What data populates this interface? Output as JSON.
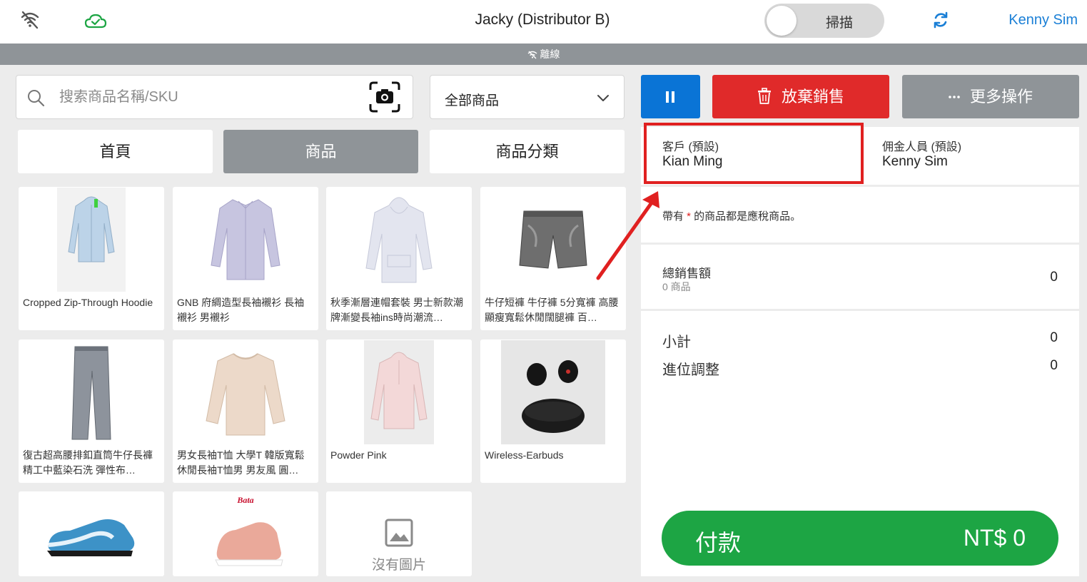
{
  "header": {
    "title": "Jacky (Distributor B)",
    "scan_label": "掃描",
    "user": "Kenny Sim"
  },
  "offline_label": "離線",
  "search": {
    "placeholder": "搜索商品名稱/SKU"
  },
  "category_filter": {
    "selected": "全部商品"
  },
  "tabs": [
    {
      "label": "首頁",
      "active": false
    },
    {
      "label": "商品",
      "active": true
    },
    {
      "label": "商品分類",
      "active": false
    }
  ],
  "products": [
    {
      "name": "Cropped Zip-Through Hoodie",
      "image": "light-blue-hoodie"
    },
    {
      "name": "GNB 府綢造型長袖襯衫 長袖襯衫 男襯衫",
      "image": "lavender-shirt"
    },
    {
      "name": "秋季漸層連帽套裝 男士新款潮牌漸變長袖ins時尚潮流…",
      "image": "grey-hoodie"
    },
    {
      "name": "牛仔短褲 牛仔褲 5分寬褲 高腰顯瘦寬鬆休閒闊腿褲 百…",
      "image": "denim-shorts"
    },
    {
      "name": "復古超高腰排釦直筒牛仔長褲 精工中藍染石洗 彈性布…",
      "image": "grey-jeans"
    },
    {
      "name": "男女長袖T恤 大學T 韓版寬鬆休閒長袖T恤男 男友風 圓…",
      "image": "beige-sweater"
    },
    {
      "name": "Powder Pink",
      "image": "pink-hoodie"
    },
    {
      "name": "Wireless-Earbuds",
      "image": "black-earbuds"
    },
    {
      "name": "",
      "image": "blue-sneaker"
    },
    {
      "name": "",
      "image": "pink-sneaker",
      "brand": "Bata"
    },
    {
      "name": "",
      "image": "no-image",
      "no_image_label": "沒有圖片"
    }
  ],
  "actions": {
    "discard_label": "放棄銷售",
    "more_label": "更多操作"
  },
  "customer": {
    "label": "客戶 (預設)",
    "value": "Kian Ming"
  },
  "commission": {
    "label": "佣金人員 (預設)",
    "value": "Kenny Sim"
  },
  "tax_note": {
    "star": "*",
    "text_before": "帶有 ",
    "text_after": " 的商品都是應稅商品。"
  },
  "summary": {
    "total_label": "總銷售額",
    "items_count": "0 商品",
    "total_value": "0",
    "subtotal_label": "小計",
    "subtotal_value": "0",
    "rounding_label": "進位調整",
    "rounding_value": "0"
  },
  "pay": {
    "label": "付款",
    "amount": "NT$ 0"
  },
  "colors": {
    "accent_blue": "#0a74d6",
    "discard_red": "#e02a2a",
    "pay_green": "#1da544",
    "grey": "#8f9498",
    "highlight_red": "#e02020"
  }
}
